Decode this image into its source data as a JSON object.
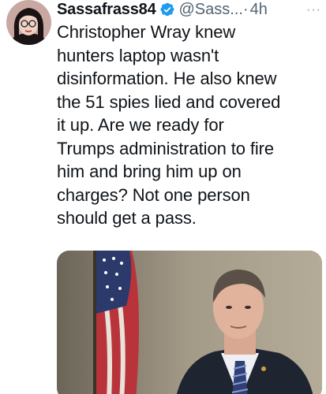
{
  "tweet": {
    "display_name": "Sassafrass84",
    "handle": "@Sass...",
    "separator": "·",
    "time": "4h",
    "more": "···",
    "text": "Christopher Wray knew\nhunters laptop wasn't\ndisinformation. He also knew\nthe 51 spies lied and covered\nit up. Are we ready for\nTrumps administration to fire\nhim and bring him up on\ncharges? Not one person\nshould get a pass.",
    "verified_color": "#1d9bf0",
    "icons": {
      "verified": "verified-badge-icon",
      "more": "more-options-icon"
    }
  }
}
